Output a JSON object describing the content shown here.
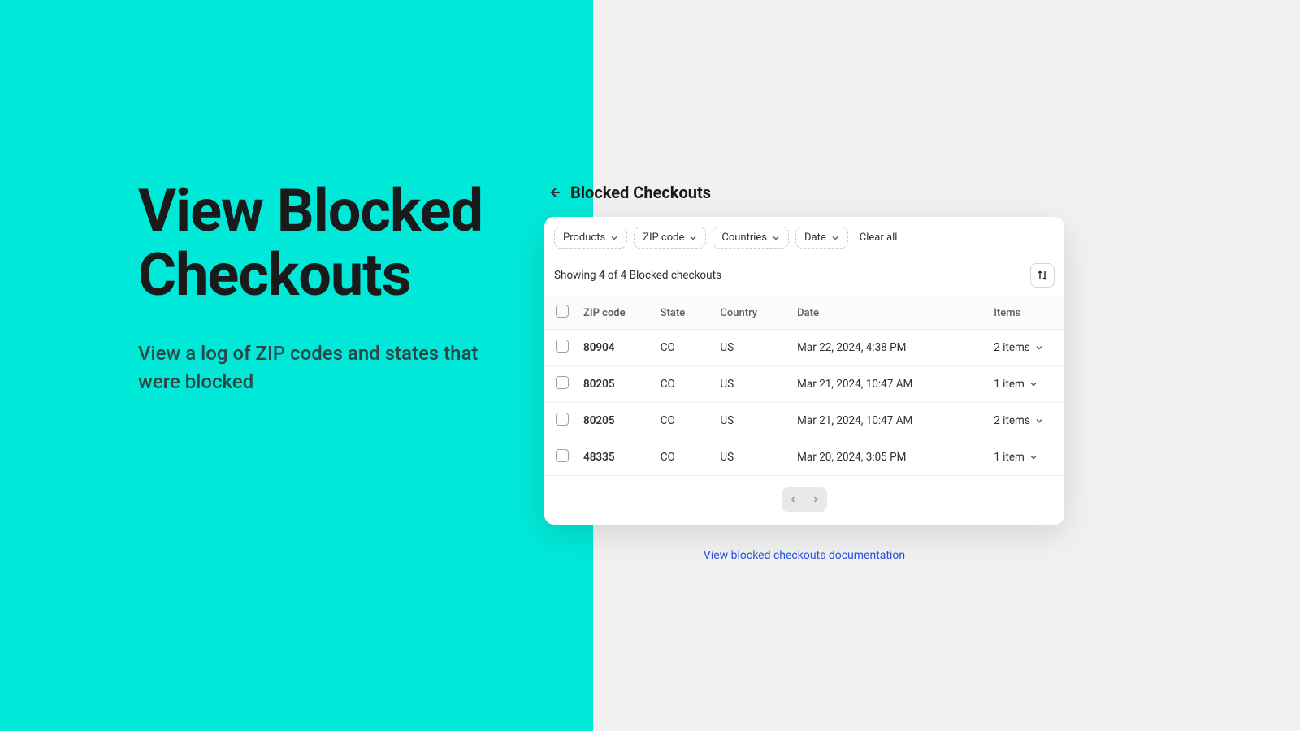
{
  "hero": {
    "title": "View Blocked Checkouts",
    "subtitle": "View a log of ZIP codes and states that were blocked"
  },
  "page": {
    "title": "Blocked Checkouts"
  },
  "filters": {
    "products": "Products",
    "zip": "ZIP code",
    "countries": "Countries",
    "date": "Date",
    "clear": "Clear all"
  },
  "meta": {
    "showing": "Showing 4 of 4 Blocked checkouts"
  },
  "columns": {
    "zip": "ZIP code",
    "state": "State",
    "country": "Country",
    "date": "Date",
    "items": "Items"
  },
  "rows": [
    {
      "zip": "80904",
      "state": "CO",
      "country": "US",
      "date": "Mar 22, 2024, 4:38 PM",
      "items": "2 items"
    },
    {
      "zip": "80205",
      "state": "CO",
      "country": "US",
      "date": "Mar 21, 2024, 10:47 AM",
      "items": "1 item"
    },
    {
      "zip": "80205",
      "state": "CO",
      "country": "US",
      "date": "Mar 21, 2024, 10:47 AM",
      "items": "2 items"
    },
    {
      "zip": "48335",
      "state": "CO",
      "country": "US",
      "date": "Mar 20, 2024, 3:05 PM",
      "items": "1 item"
    }
  ],
  "link": {
    "docs": "View blocked checkouts documentation"
  }
}
